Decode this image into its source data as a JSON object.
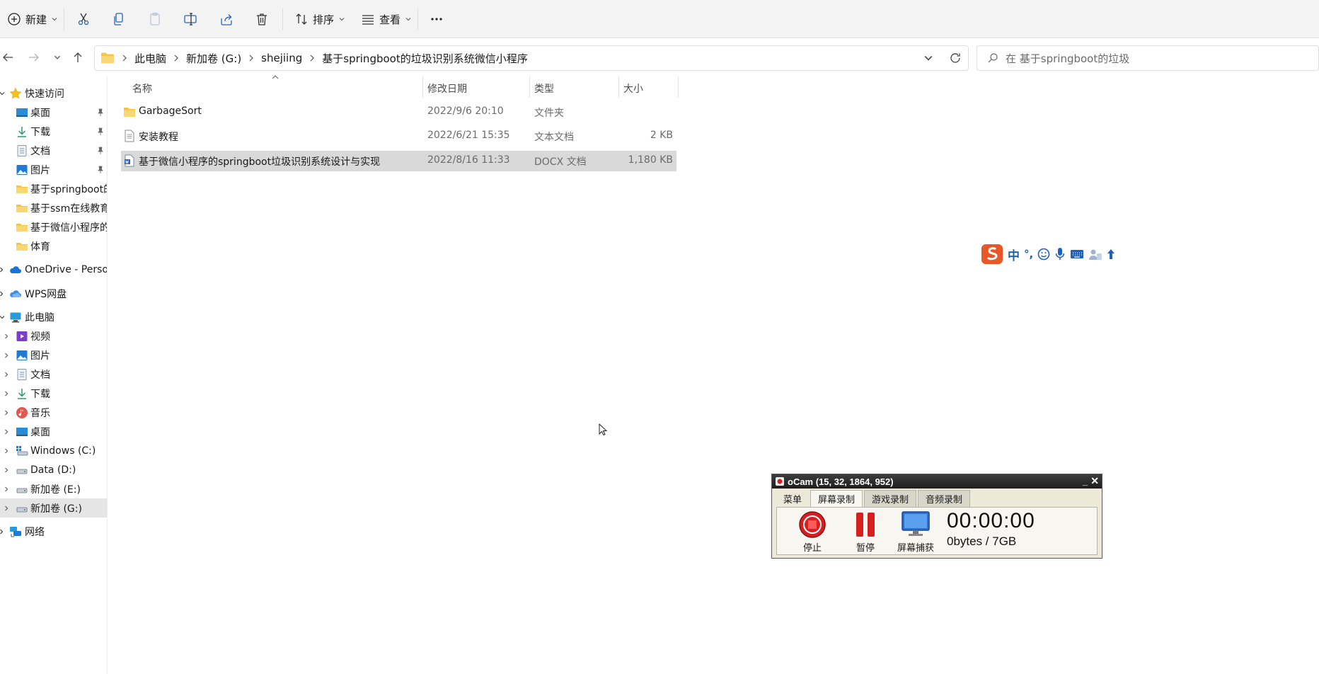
{
  "toolbar": {
    "new_label": "新建",
    "sort_label": "排序",
    "view_label": "查看"
  },
  "breadcrumb": [
    "此电脑",
    "新加卷 (G:)",
    "shejiing",
    "基于springboot的垃圾识别系统微信小程序"
  ],
  "search": {
    "placeholder": "在 基于springboot的垃圾"
  },
  "sidebar": {
    "quick_access": "快速访问",
    "quick_items": [
      {
        "label": "桌面",
        "icon": "desktop-icon",
        "pinned": true
      },
      {
        "label": "下载",
        "icon": "download-icon",
        "pinned": true
      },
      {
        "label": "文档",
        "icon": "document-icon",
        "pinned": true
      },
      {
        "label": "图片",
        "icon": "pictures-icon",
        "pinned": true
      },
      {
        "label": "基于springboot的垃",
        "icon": "folder-icon"
      },
      {
        "label": "基于ssm在线教育系",
        "icon": "folder-icon"
      },
      {
        "label": "基于微信小程序的sp",
        "icon": "folder-icon"
      },
      {
        "label": "体育",
        "icon": "folder-icon"
      }
    ],
    "onedrive": "OneDrive - Persona",
    "wps": "WPS网盘",
    "this_pc": "此电脑",
    "pc_items": [
      {
        "label": "视频",
        "icon": "video-icon"
      },
      {
        "label": "图片",
        "icon": "pictures-icon"
      },
      {
        "label": "文档",
        "icon": "document-icon"
      },
      {
        "label": "下载",
        "icon": "download-icon"
      },
      {
        "label": "音乐",
        "icon": "music-icon"
      },
      {
        "label": "桌面",
        "icon": "desktop-icon"
      },
      {
        "label": "Windows (C:)",
        "icon": "drive-icon"
      },
      {
        "label": "Data (D:)",
        "icon": "drive-icon"
      },
      {
        "label": "新加卷 (E:)",
        "icon": "drive-icon"
      },
      {
        "label": "新加卷 (G:)",
        "icon": "drive-icon",
        "selected": true
      }
    ],
    "network": "网络"
  },
  "columns": {
    "name": "名称",
    "modified": "修改日期",
    "type": "类型",
    "size": "大小"
  },
  "files": [
    {
      "name": "GarbageSort",
      "modified": "2022/9/6 20:10",
      "type": "文件夹",
      "size": "",
      "icon": "folder-icon"
    },
    {
      "name": "安装教程",
      "modified": "2022/6/21 15:35",
      "type": "文本文档",
      "size": "2 KB",
      "icon": "text-file-icon"
    },
    {
      "name": "基于微信小程序的springboot垃圾识别系统设计与实现",
      "modified": "2022/8/16 11:33",
      "type": "DOCX 文档",
      "size": "1,180 KB",
      "icon": "docx-file-icon",
      "selected": true
    }
  ],
  "ime": {
    "mode": "中",
    "punct": "°,"
  },
  "ocam": {
    "title": "oCam (15, 32, 1864, 952)",
    "tabs": [
      "菜单",
      "屏幕录制",
      "游戏录制",
      "音频录制"
    ],
    "active_tab": "屏幕录制",
    "stop_label": "停止",
    "pause_label": "暂停",
    "capture_label": "屏幕捕获",
    "timer": "00:00:00",
    "size": "0bytes / 7GB"
  },
  "colors": {
    "accent": "#0067c0",
    "folder": "#f4c542",
    "selection": "#d9d9d9",
    "ocam_stop": "#d62020"
  }
}
